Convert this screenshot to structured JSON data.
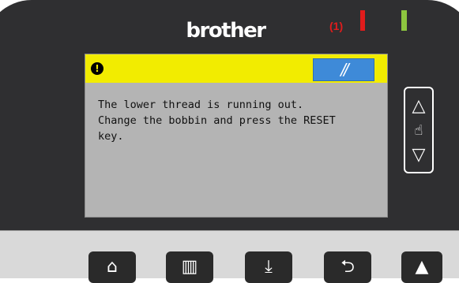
{
  "panel": {
    "brand": "brother",
    "callout": "(1)",
    "colors": {
      "led_red": "#e11c1c",
      "led_green": "#8dc63f",
      "warning_bar": "#f2ec00",
      "ack_button": "#3e8ad8"
    }
  },
  "screen": {
    "warning_icon": "!",
    "ack_label": "//",
    "message": "The lower thread is running out.\nChange the bobbin and press the RESET\nkey."
  },
  "scroll": {
    "up": "△",
    "hand": "☝",
    "down": "▽"
  },
  "keys": {
    "home": "⌂",
    "bobbin": "▥",
    "cut": "⤓",
    "return": "⮌",
    "up": "▲"
  }
}
